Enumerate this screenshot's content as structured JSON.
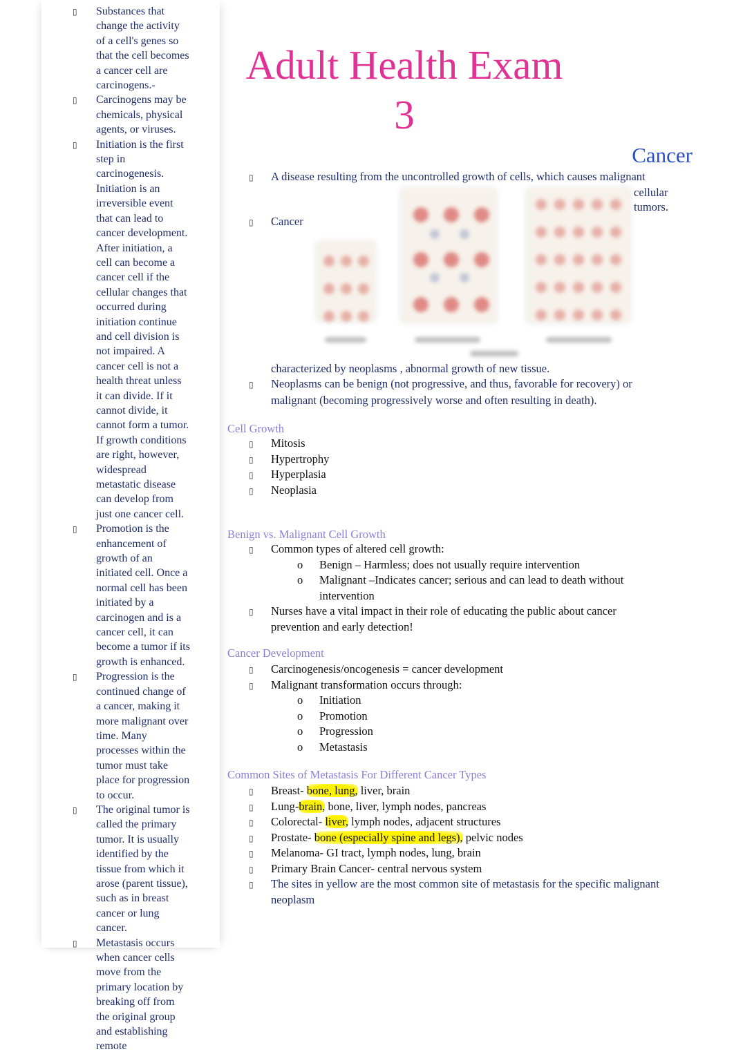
{
  "sidebar": {
    "items": [
      {
        "term": "",
        "text": "Substances that change the activity of a cell's genes so that the cell becomes a cancer cell are carcinogens.-"
      },
      {
        "term": "",
        "text": "Carcinogens may be chemicals, physical agents, or viruses."
      },
      {
        "term": "Initiation",
        "text": " is the first step in carcinogenesis. Initiation is an irreversible event that can lead to cancer development. After initiation, a cell can become a cancer cell if the cellular changes that occurred during initiation continue and cell division is not impaired. A cancer cell is not a health threat unless it can divide. If it cannot divide, it cannot form a tumor. If growth conditions are right, however, widespread metastatic disease can develop from just one cancer cell."
      },
      {
        "term": "Promotion",
        "text": " is the enhancement of growth of an initiated cell. Once a normal cell has been initiated by a carcinogen and is a cancer cell, it can become a tumor if its growth is enhanced."
      },
      {
        "term": "Progression",
        "text": " is the continued change of a cancer, making it more malignant over time. Many processes within the tumor must take place for progression to occur."
      },
      {
        "term": "",
        "text": "The original tumor is called the primary tumor. It is usually identified by the tissue from which it arose (parent tissue), such as in breast cancer or lung cancer."
      },
      {
        "term": "Metastasis",
        "text": "  occurs when cancer cells move from the primary location by breaking off from the original group and establishing remote"
      }
    ]
  },
  "document": {
    "title": "Adult Health Exam 3",
    "section_title": "Cancer",
    "definition": "A disease resulting from the uncontrolled growth of cells, which causes malignant",
    "definition_cont": "cellular tumors.",
    "cancer_item": "Cancer",
    "characterized": "characterized by  neoplasms , abnormal growth of new tissue.",
    "neoplasms": "Neoplasms  can be  benign (not progressive, and thus, favorable for recovery) or malignant  (becoming progressively worse and often resulting in death).",
    "figure_caption": "illustration (blurred)"
  },
  "cell_growth": {
    "heading": "Cell Growth",
    "items": [
      "Mitosis",
      "Hypertrophy",
      "Hyperplasia",
      "Neoplasia"
    ]
  },
  "benign_malignant": {
    "heading": "Benign vs. Malignant Cell Growth",
    "item1": "Common types of altered cell growth:",
    "sub": [
      "Benign – Harmless; does not usually require intervention",
      "Malignant –Indicates cancer; serious and can lead to death without intervention"
    ],
    "item2": "Nurses have a vital impact in their role of educating the public about cancer prevention and early detection!"
  },
  "cancer_development": {
    "heading": "Cancer Development",
    "item1": "Carcinogenesis/oncogenesis = cancer development",
    "item2": "Malignant transformation occurs through:",
    "sub": [
      "Initiation",
      "Promotion",
      "Progression",
      "Metastasis"
    ]
  },
  "metastasis_sites": {
    "heading": "Common Sites of Metastasis For Different Cancer Types",
    "rows": [
      {
        "pre": "Breast- ",
        "hl": "bone, lung,",
        "post": " liver, brain"
      },
      {
        "pre": "Lung-",
        "hl": "brain,",
        "post": " bone, liver, lymph nodes, pancreas"
      },
      {
        "pre": "Colorectal- ",
        "hl": "liver,",
        "post": " lymph nodes, adjacent structures"
      },
      {
        "pre": "Prostate-  ",
        "hl": "bone (especially spine and legs),",
        "post": " pelvic nodes"
      },
      {
        "pre": "Melanoma- GI tract, lymph nodes, lung, brain",
        "hl": "",
        "post": ""
      },
      {
        "pre": "Primary Brain Cancer- central nervous system",
        "hl": "",
        "post": ""
      }
    ],
    "note": "The sites in yellow are the most common site of metastasis for the specific malignant neoplasm",
    "highlight_color": "#fff200"
  },
  "colors": {
    "title": "#e03194",
    "section": "#2b4fc4",
    "heading": "#8b7ddb",
    "body_navy": "#1f2d6b"
  },
  "icons": {
    "bullet": "missing-glyph-box",
    "sub_bullet": "o"
  }
}
